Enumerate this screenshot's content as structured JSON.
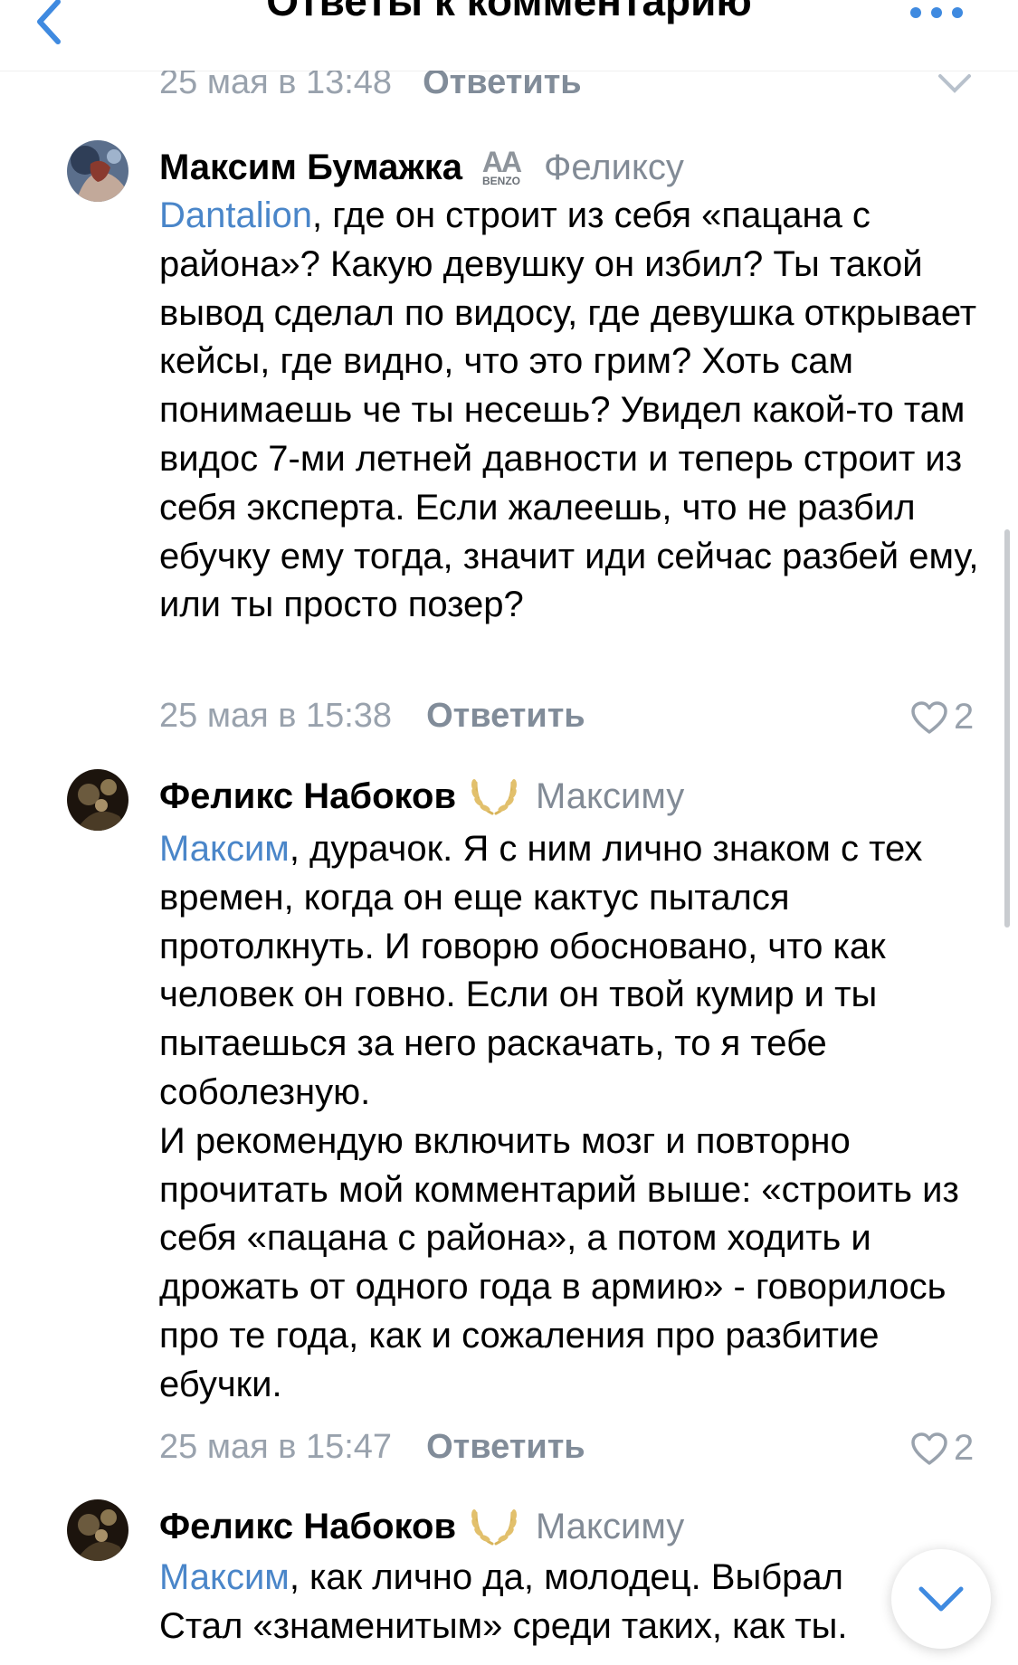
{
  "header": {
    "title": "Ответы к комментарию"
  },
  "previous_comment": {
    "date": "25 мая в 13:48",
    "reply_label": "Ответить"
  },
  "comments": [
    {
      "author": "Максим Бумажка",
      "badge_text": "AA BENZO",
      "reply_to": "Феликсу",
      "mention": "Dantalion",
      "text": ", где он строит из себя «пацана с района»? Какую девушку он избил? Ты такой вывод сделал по видосу, где девушка открывает кейсы, где видно, что это грим? Хоть сам понимаешь че ты несешь? Увидел какой-то там видос 7-ми летней давности и теперь строит из себя эксперта. Если жалеешь, что не разбил ебучку ему тогда, значит иди сейчас разбей ему, или ты просто позер?",
      "date": "25 мая в 15:38",
      "reply_label": "Ответить",
      "likes": "2"
    },
    {
      "author": "Феликс Набоков",
      "reply_to": "Максиму",
      "mention": "Максим",
      "text": ", дурачок. Я с ним лично знаком с тех времен, когда он еще кактус пытался протолкнуть. И говорю обосновано, что как человек он говно. Если он твой кумир и ты пытаешься за него раскачать, то я тебе соболезную.\nИ рекомендую включить мозг и повторно прочитать мой комментарий выше: «строить из себя «пацана с района», а потом ходить и дрожать от одного года в армию» - говорилось про те года, как и сожаления про разбитие ебучки.",
      "date": "25 мая в 15:47",
      "reply_label": "Ответить",
      "likes": "2"
    },
    {
      "author": "Феликс Набоков",
      "reply_to": "Максиму",
      "mention": "Максим",
      "text": ", как лично да, молодец. Выбрал\nСтал «знаменитым» среди таких, как ты."
    }
  ],
  "colors": {
    "accent": "#4a86c9",
    "secondary_text": "#99a2ad",
    "icon_blue": "#3f8ae0"
  },
  "icons": {
    "back": "chevron-left-icon",
    "more": "more-dots-icon",
    "like": "heart-outline-icon",
    "laurel": "laurel-wreath-icon",
    "scroll": "chevron-down-icon"
  }
}
